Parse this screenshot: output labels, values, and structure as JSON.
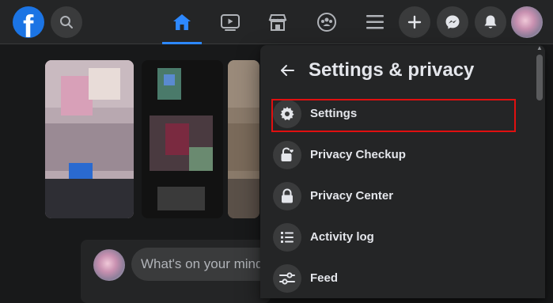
{
  "topbar": {
    "logo_letter": "f",
    "icons": {
      "search": "search-icon",
      "home": "home-icon",
      "watch": "watch-icon",
      "marketplace": "marketplace-icon",
      "groups": "groups-icon",
      "menu": "menu-icon",
      "create": "plus-icon",
      "messenger": "messenger-icon",
      "notifications": "bell-icon"
    },
    "active_tab": "home",
    "accent_color": "#2d88ff"
  },
  "composer": {
    "placeholder": "What's on your mind"
  },
  "settings_panel": {
    "title": "Settings & privacy",
    "items": [
      {
        "label": "Settings",
        "icon": "gear-icon",
        "highlighted": true
      },
      {
        "label": "Privacy Checkup",
        "icon": "lock-heart-icon"
      },
      {
        "label": "Privacy Center",
        "icon": "lock-icon"
      },
      {
        "label": "Activity log",
        "icon": "list-icon"
      },
      {
        "label": "Feed",
        "icon": "sliders-icon"
      }
    ],
    "highlight_color": "#e01010"
  }
}
